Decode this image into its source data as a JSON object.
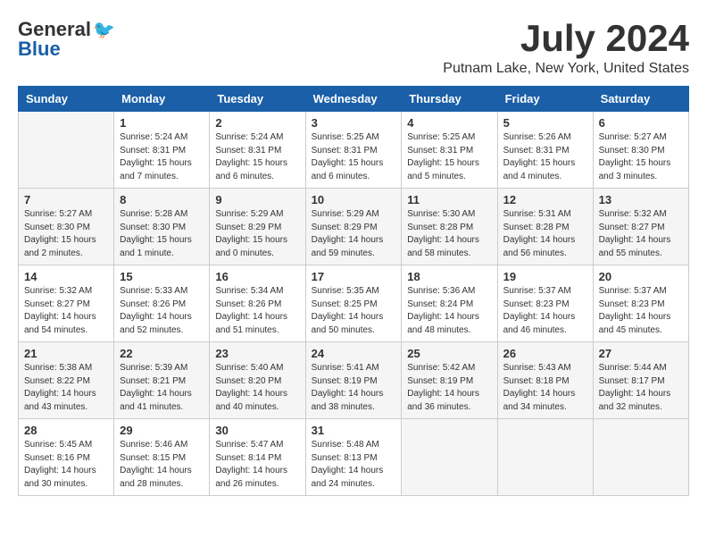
{
  "header": {
    "logo_general": "General",
    "logo_blue": "Blue",
    "month": "July 2024",
    "location": "Putnam Lake, New York, United States"
  },
  "days_of_week": [
    "Sunday",
    "Monday",
    "Tuesday",
    "Wednesday",
    "Thursday",
    "Friday",
    "Saturday"
  ],
  "weeks": [
    [
      {
        "day": "",
        "info": ""
      },
      {
        "day": "1",
        "info": "Sunrise: 5:24 AM\nSunset: 8:31 PM\nDaylight: 15 hours\nand 7 minutes."
      },
      {
        "day": "2",
        "info": "Sunrise: 5:24 AM\nSunset: 8:31 PM\nDaylight: 15 hours\nand 6 minutes."
      },
      {
        "day": "3",
        "info": "Sunrise: 5:25 AM\nSunset: 8:31 PM\nDaylight: 15 hours\nand 6 minutes."
      },
      {
        "day": "4",
        "info": "Sunrise: 5:25 AM\nSunset: 8:31 PM\nDaylight: 15 hours\nand 5 minutes."
      },
      {
        "day": "5",
        "info": "Sunrise: 5:26 AM\nSunset: 8:31 PM\nDaylight: 15 hours\nand 4 minutes."
      },
      {
        "day": "6",
        "info": "Sunrise: 5:27 AM\nSunset: 8:30 PM\nDaylight: 15 hours\nand 3 minutes."
      }
    ],
    [
      {
        "day": "7",
        "info": "Sunrise: 5:27 AM\nSunset: 8:30 PM\nDaylight: 15 hours\nand 2 minutes."
      },
      {
        "day": "8",
        "info": "Sunrise: 5:28 AM\nSunset: 8:30 PM\nDaylight: 15 hours\nand 1 minute."
      },
      {
        "day": "9",
        "info": "Sunrise: 5:29 AM\nSunset: 8:29 PM\nDaylight: 15 hours\nand 0 minutes."
      },
      {
        "day": "10",
        "info": "Sunrise: 5:29 AM\nSunset: 8:29 PM\nDaylight: 14 hours\nand 59 minutes."
      },
      {
        "day": "11",
        "info": "Sunrise: 5:30 AM\nSunset: 8:28 PM\nDaylight: 14 hours\nand 58 minutes."
      },
      {
        "day": "12",
        "info": "Sunrise: 5:31 AM\nSunset: 8:28 PM\nDaylight: 14 hours\nand 56 minutes."
      },
      {
        "day": "13",
        "info": "Sunrise: 5:32 AM\nSunset: 8:27 PM\nDaylight: 14 hours\nand 55 minutes."
      }
    ],
    [
      {
        "day": "14",
        "info": "Sunrise: 5:32 AM\nSunset: 8:27 PM\nDaylight: 14 hours\nand 54 minutes."
      },
      {
        "day": "15",
        "info": "Sunrise: 5:33 AM\nSunset: 8:26 PM\nDaylight: 14 hours\nand 52 minutes."
      },
      {
        "day": "16",
        "info": "Sunrise: 5:34 AM\nSunset: 8:26 PM\nDaylight: 14 hours\nand 51 minutes."
      },
      {
        "day": "17",
        "info": "Sunrise: 5:35 AM\nSunset: 8:25 PM\nDaylight: 14 hours\nand 50 minutes."
      },
      {
        "day": "18",
        "info": "Sunrise: 5:36 AM\nSunset: 8:24 PM\nDaylight: 14 hours\nand 48 minutes."
      },
      {
        "day": "19",
        "info": "Sunrise: 5:37 AM\nSunset: 8:23 PM\nDaylight: 14 hours\nand 46 minutes."
      },
      {
        "day": "20",
        "info": "Sunrise: 5:37 AM\nSunset: 8:23 PM\nDaylight: 14 hours\nand 45 minutes."
      }
    ],
    [
      {
        "day": "21",
        "info": "Sunrise: 5:38 AM\nSunset: 8:22 PM\nDaylight: 14 hours\nand 43 minutes."
      },
      {
        "day": "22",
        "info": "Sunrise: 5:39 AM\nSunset: 8:21 PM\nDaylight: 14 hours\nand 41 minutes."
      },
      {
        "day": "23",
        "info": "Sunrise: 5:40 AM\nSunset: 8:20 PM\nDaylight: 14 hours\nand 40 minutes."
      },
      {
        "day": "24",
        "info": "Sunrise: 5:41 AM\nSunset: 8:19 PM\nDaylight: 14 hours\nand 38 minutes."
      },
      {
        "day": "25",
        "info": "Sunrise: 5:42 AM\nSunset: 8:19 PM\nDaylight: 14 hours\nand 36 minutes."
      },
      {
        "day": "26",
        "info": "Sunrise: 5:43 AM\nSunset: 8:18 PM\nDaylight: 14 hours\nand 34 minutes."
      },
      {
        "day": "27",
        "info": "Sunrise: 5:44 AM\nSunset: 8:17 PM\nDaylight: 14 hours\nand 32 minutes."
      }
    ],
    [
      {
        "day": "28",
        "info": "Sunrise: 5:45 AM\nSunset: 8:16 PM\nDaylight: 14 hours\nand 30 minutes."
      },
      {
        "day": "29",
        "info": "Sunrise: 5:46 AM\nSunset: 8:15 PM\nDaylight: 14 hours\nand 28 minutes."
      },
      {
        "day": "30",
        "info": "Sunrise: 5:47 AM\nSunset: 8:14 PM\nDaylight: 14 hours\nand 26 minutes."
      },
      {
        "day": "31",
        "info": "Sunrise: 5:48 AM\nSunset: 8:13 PM\nDaylight: 14 hours\nand 24 minutes."
      },
      {
        "day": "",
        "info": ""
      },
      {
        "day": "",
        "info": ""
      },
      {
        "day": "",
        "info": ""
      }
    ]
  ]
}
